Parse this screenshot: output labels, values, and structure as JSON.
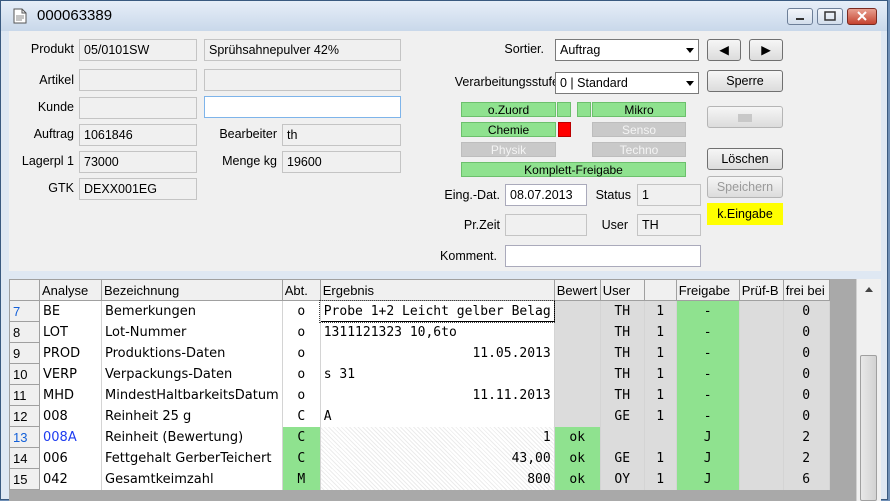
{
  "window": {
    "title": "000063389"
  },
  "form": {
    "produkt_label": "Produkt",
    "produkt_code": "05/0101SW",
    "produkt_name": "Sprühsahnepulver 42%",
    "artikel_label": "Artikel",
    "artikel_value": "",
    "artikel_value2": "",
    "kunde_label": "Kunde",
    "kunde_value": "",
    "kunde_value2": "",
    "auftrag_label": "Auftrag",
    "auftrag_value": "1061846",
    "bearbeiter_label": "Bearbeiter",
    "bearbeiter_value": "th",
    "lagerpl_label": "Lagerpl 1",
    "lagerpl_value": "73000",
    "menge_label": "Menge kg",
    "menge_value": "19600",
    "gtk_label": "GTK",
    "gtk_value": "DEXX001EG",
    "sortier_label": "Sortier.",
    "sortier_value": "Auftrag",
    "verarb_label": "Verarbeitungsstufe",
    "verarb_value": "0 | Standard",
    "eing_label": "Eing.-Dat.",
    "eing_value": "08.07.2013",
    "status_label": "Status",
    "status_value": "1",
    "przeit_label": "Pr.Zeit",
    "przeit_value": "",
    "user_label": "User",
    "user_value": "TH",
    "komment_label": "Komment.",
    "komment_value": ""
  },
  "tags": {
    "ozuord": "o.Zuord",
    "mikro": "Mikro",
    "chemie": "Chemie",
    "senso": "Senso",
    "physik": "Physik",
    "techno": "Techno",
    "komplett": "Komplett-Freigabe",
    "colors": {
      "green": "#8fe28f",
      "red": "#ff0000",
      "gray": "#c9c9c9"
    }
  },
  "buttons": {
    "prev": "◀",
    "next": "▶",
    "sperre": "Sperre",
    "blank": "",
    "loeschen": "Löschen",
    "speichern": "Speichern",
    "keingabe": "k.Eingabe",
    "keingabe_color": "#ffff00"
  },
  "grid": {
    "headers": [
      "",
      "Analyse",
      "Bezeichnung",
      "Abt.",
      "Ergebnis",
      "Bewert",
      "User",
      "",
      "Freigabe",
      "Prüf-B",
      "frei bei"
    ],
    "rows": [
      [
        "7",
        "BE",
        "Bemerkungen",
        "o",
        "Probe 1+2 Leicht gelber Belag",
        "",
        "TH",
        "1",
        "-",
        "",
        "0"
      ],
      [
        "8",
        "LOT",
        "Lot-Nummer",
        "o",
        "1311121323  10,6to",
        "",
        "TH",
        "1",
        "-",
        "",
        "0"
      ],
      [
        "9",
        "PROD",
        "Produktions-Daten",
        "o",
        "11.05.2013",
        "",
        "TH",
        "1",
        "-",
        "",
        "0"
      ],
      [
        "10",
        "VERP",
        "Verpackungs-Daten",
        "o",
        "s 31",
        "",
        "TH",
        "1",
        "-",
        "",
        "0"
      ],
      [
        "11",
        "MHD",
        "MindestHaltbarkeitsDatum",
        "o",
        "11.11.2013",
        "",
        "TH",
        "1",
        "-",
        "",
        "0"
      ],
      [
        "12",
        "008",
        "Reinheit 25 g",
        "C",
        "A",
        "",
        "GE",
        "1",
        "-",
        "",
        "0"
      ],
      [
        "13",
        "008A",
        "Reinheit (Bewertung)",
        "C",
        "1",
        "ok",
        "",
        "",
        "J",
        "",
        "2"
      ],
      [
        "14",
        "006",
        "Fettgehalt GerberTeichert",
        "C",
        "43,00",
        "ok",
        "GE",
        "1",
        "J",
        "",
        "2"
      ],
      [
        "15",
        "042",
        "Gesamtkeimzahl",
        "M",
        "800",
        "ok",
        "OY",
        "1",
        "J",
        "",
        "6"
      ]
    ]
  }
}
